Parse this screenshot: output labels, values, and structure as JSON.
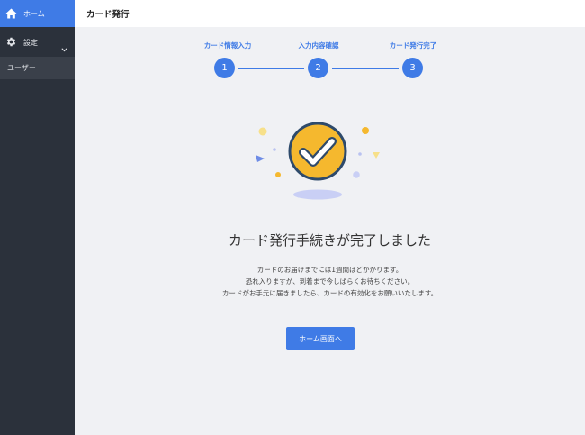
{
  "sidebar": {
    "home_label": "ホーム",
    "settings_label": "設定",
    "user_label": "ユーザー"
  },
  "header": {
    "title": "カード発行"
  },
  "steps": [
    {
      "label": "カード情報入力",
      "number": "1"
    },
    {
      "label": "入力内容確認",
      "number": "2"
    },
    {
      "label": "カード発行完了",
      "number": "3"
    }
  ],
  "main": {
    "title": "カード発行手続きが完了しました",
    "messages": [
      "カードのお届けまでには1週間ほどかかります。",
      "恐れ入りますが、到着まで今しばらくお待ちください。",
      "カードがお手元に届きましたら、カードの有効化をお願いいたします。"
    ],
    "home_button_label": "ホーム画面へ"
  },
  "colors": {
    "accent": "#3f7be6",
    "sidebar_bg": "#2b313b",
    "check_fill": "#f5b82e",
    "check_ring": "#2e4a6b"
  }
}
